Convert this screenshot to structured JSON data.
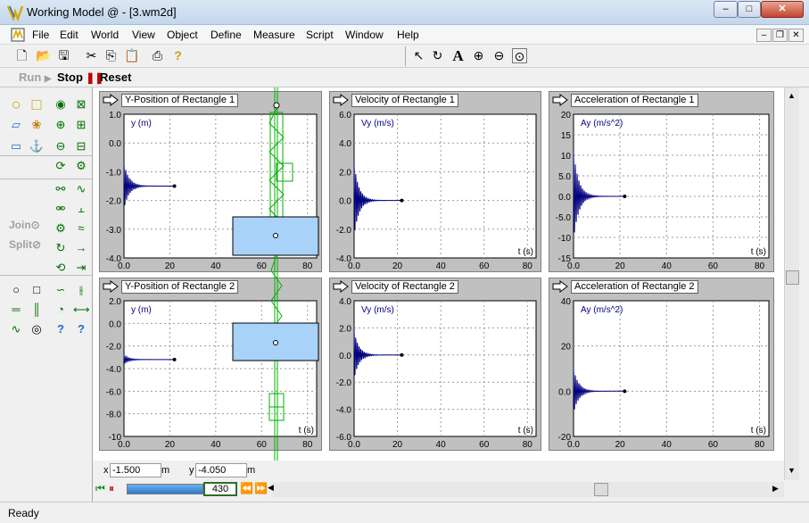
{
  "window": {
    "title": "Working Model @ - [3.wm2d]"
  },
  "menu": [
    "File",
    "Edit",
    "World",
    "View",
    "Object",
    "Define",
    "Measure",
    "Script",
    "Window",
    "Help"
  ],
  "runbar": {
    "run_label": "Run",
    "stop_label": "Stop",
    "reset_label": "Reset"
  },
  "palette": {
    "join_label": "Join",
    "split_label": "Split"
  },
  "meters": [
    {
      "title": "Y-Position of Rectangle 1",
      "ylabel": "y (m)",
      "xlabel": "",
      "ymin": -4,
      "ymax": 1,
      "yticks": [
        1,
        0,
        -1,
        -2,
        -3,
        -4
      ],
      "ytick_labels": [
        "1.0",
        "0.0",
        "-1.0",
        "-2.0",
        "-3.0",
        "-4.0"
      ],
      "xticks": [
        0,
        20,
        40,
        60,
        80
      ],
      "xtick_labels": [
        "0.0",
        "20",
        "40",
        "60",
        "80"
      ],
      "trace": "y1"
    },
    {
      "title": "Velocity of Rectangle 1",
      "ylabel": "Vy (m/s)",
      "xlabel": "t (s)",
      "ymin": -4,
      "ymax": 6,
      "yticks": [
        6,
        4,
        2,
        0,
        -2,
        -4
      ],
      "ytick_labels": [
        "6.0",
        "4.0",
        "2.0",
        "0.0",
        "-2.0",
        "-4.0"
      ],
      "xticks": [
        0,
        20,
        40,
        60,
        80
      ],
      "xtick_labels": [
        "0.0",
        "20",
        "40",
        "60",
        "80"
      ],
      "trace": "v1"
    },
    {
      "title": "Acceleration of Rectangle 1",
      "ylabel": "Ay (m/s^2)",
      "xlabel": "t (s)",
      "ymin": -15,
      "ymax": 20,
      "yticks": [
        20,
        15,
        10,
        5,
        0,
        -5,
        -10,
        -15
      ],
      "ytick_labels": [
        "20",
        "15",
        "10",
        "5.0",
        "0.0",
        "-5.0",
        "-10",
        "-15"
      ],
      "xticks": [
        0,
        20,
        40,
        60,
        80
      ],
      "xtick_labels": [
        "0.0",
        "20",
        "40",
        "60",
        "80"
      ],
      "trace": "a1"
    },
    {
      "title": "Y-Position of Rectangle 2",
      "ylabel": "y (m)",
      "xlabel": "t (s)",
      "ymin": -10,
      "ymax": 2,
      "yticks": [
        2,
        0,
        -2,
        -4,
        -6,
        -8,
        -10
      ],
      "ytick_labels": [
        "2.0",
        "0.0",
        "-2.0",
        "-4.0",
        "-6.0",
        "-8.0",
        "-10"
      ],
      "xticks": [
        0,
        20,
        40,
        60,
        80
      ],
      "xtick_labels": [
        "0.0",
        "20",
        "40",
        "60",
        "80"
      ],
      "trace": "y2"
    },
    {
      "title": "Velocity of Rectangle 2",
      "ylabel": "Vy (m/s)",
      "xlabel": "t (s)",
      "ymin": -6,
      "ymax": 4,
      "yticks": [
        4,
        2,
        0,
        -2,
        -4,
        -6
      ],
      "ytick_labels": [
        "4.0",
        "2.0",
        "0.0",
        "-2.0",
        "-4.0",
        "-6.0"
      ],
      "xticks": [
        0,
        20,
        40,
        60,
        80
      ],
      "xtick_labels": [
        "0.0",
        "20",
        "40",
        "60",
        "80"
      ],
      "trace": "v2"
    },
    {
      "title": "Acceleration of Rectangle 2",
      "ylabel": "Ay (m/s^2)",
      "xlabel": "t (s)",
      "ymin": -20,
      "ymax": 40,
      "yticks": [
        40,
        20,
        0,
        -20
      ],
      "ytick_labels": [
        "40",
        "20",
        "0.0",
        "-20"
      ],
      "xticks": [
        0,
        20,
        40,
        60,
        80
      ],
      "xtick_labels": [
        "0.0",
        "20",
        "40",
        "60",
        "80"
      ],
      "trace": "a2"
    }
  ],
  "coordinates": {
    "x_label": "x",
    "x_value": "-1.500",
    "x_unit": "m",
    "y_label": "y",
    "y_value": "-4.050",
    "y_unit": "m"
  },
  "tape": {
    "frame": "430"
  },
  "status": "Ready",
  "colors": {
    "trace": "#00007f",
    "rectangle_fill": "#a8d2f7",
    "spring": "#00c000",
    "meter_bg": "#c0c0c0"
  }
}
